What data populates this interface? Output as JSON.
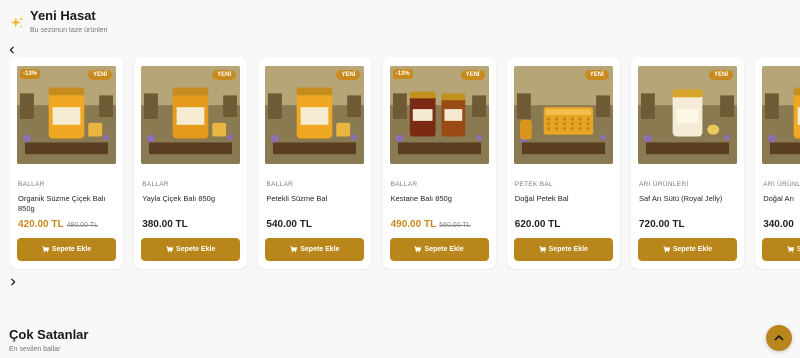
{
  "section_new": {
    "title": "Yeni Hasat",
    "subtitle": "Bu sezonun taze ürünleri",
    "icon": "sparkles-icon"
  },
  "carousel": {
    "prev_icon": "chevron-left-icon",
    "next_icon": "chevron-right-icon",
    "products": [
      {
        "category": "BALLAR",
        "name": "Organik Süzme Çiçek Balı 850g",
        "price": "420.00 TL",
        "old_price": "480.00 TL",
        "discount": "-13%",
        "badge": "YENİ",
        "on_sale": true,
        "image": "honey-jar-photo",
        "button": "Sepete Ekle"
      },
      {
        "category": "BALLAR",
        "name": "Yayla Çiçek Balı 850g",
        "price": "380.00 TL",
        "old_price": "",
        "discount": "",
        "badge": "YENİ",
        "on_sale": false,
        "image": "honey-jar-photo",
        "button": "Sepete Ekle"
      },
      {
        "category": "BALLAR",
        "name": "Petekli Süzme Bal",
        "price": "540.00 TL",
        "old_price": "",
        "discount": "",
        "badge": "YENİ",
        "on_sale": false,
        "image": "honey-jar-photo",
        "button": "Sepete Ekle"
      },
      {
        "category": "BALLAR",
        "name": "Kestane Balı 850g",
        "price": "490.00 TL",
        "old_price": "560.00 TL",
        "discount": "-13%",
        "badge": "YENİ",
        "on_sale": true,
        "image": "chestnut-honey-photo",
        "button": "Sepete Ekle"
      },
      {
        "category": "PETEK BAL",
        "name": "Doğal Petek Bal",
        "price": "620.00 TL",
        "old_price": "",
        "discount": "",
        "badge": "YENİ",
        "on_sale": false,
        "image": "honeycomb-photo",
        "button": "Sepete Ekle"
      },
      {
        "category": "ARI ÜRÜNLERİ",
        "name": "Saf Arı Sütü (Royal Jelly)",
        "price": "720.00 TL",
        "old_price": "",
        "discount": "",
        "badge": "YENİ",
        "on_sale": false,
        "image": "royal-jelly-photo",
        "button": "Sepete Ekle"
      },
      {
        "category": "ARI ÜRÜNLERİ",
        "name": "Doğal Arı",
        "price": "340.00",
        "old_price": "",
        "discount": "",
        "badge": "",
        "on_sale": false,
        "image": "honey-jar-photo",
        "button": "Sepete Ekle"
      }
    ]
  },
  "section_best": {
    "title": "Çok Satanlar",
    "subtitle": "En sevilen ballar"
  },
  "scroll_top_icon": "chevron-up-icon",
  "colors": {
    "accent": "#b8861a",
    "badge": "#c98a1d",
    "sale_price": "#c98a1d"
  }
}
